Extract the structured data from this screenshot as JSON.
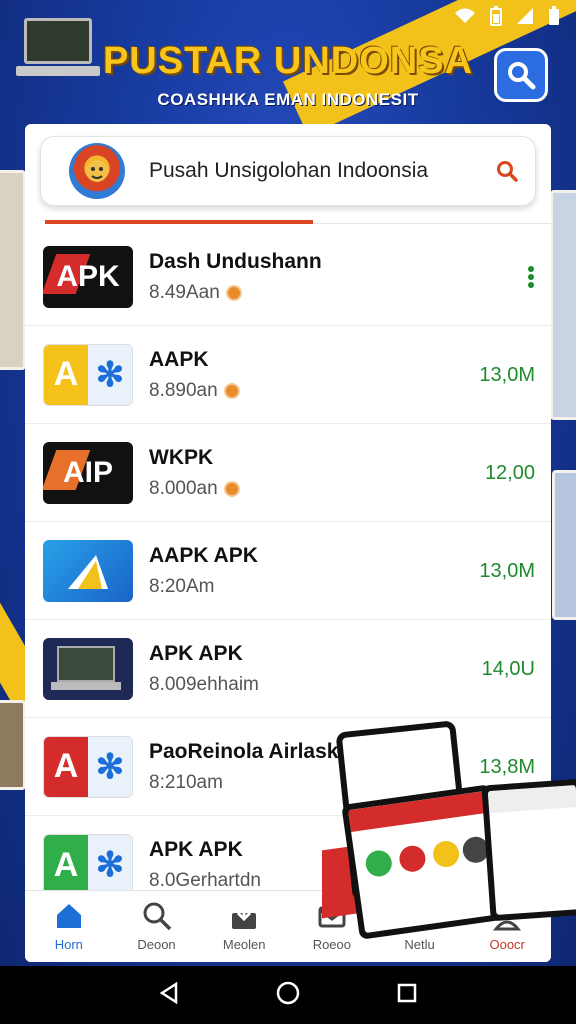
{
  "banner": {
    "title": "PUSTAR UNDONSA",
    "subtitle": "COASHHKA EMAN INDONESIT"
  },
  "search": {
    "placeholder": "Pusah Unsigolohan Indoonsia"
  },
  "apps": [
    {
      "name": "Dash Undushann",
      "size": "8.49Aan",
      "count": "",
      "icon": "apk-black-red"
    },
    {
      "name": "AAPK",
      "size": "8.890an",
      "count": "13,0M",
      "icon": "yellow-blue-split"
    },
    {
      "name": "WKPK",
      "size": "8.000an",
      "count": "12,00",
      "icon": "apk-black-orange"
    },
    {
      "name": "AAPK APK",
      "size": "8:20Am",
      "count": "13,0M",
      "icon": "blue-gradient"
    },
    {
      "name": "APK APK",
      "size": "8.009ehhaim",
      "count": "14,0U",
      "icon": "laptop"
    },
    {
      "name": "PaoReinola Airlask",
      "size": "8:210am",
      "count": "13,8M",
      "icon": "red-blue-split"
    },
    {
      "name": "APK APK",
      "size": "8.0Gerhartdn",
      "count": "",
      "icon": "green-blue-split"
    }
  ],
  "nav": [
    {
      "label": "Horn",
      "icon": "home-icon"
    },
    {
      "label": "Deoon",
      "icon": "search-icon"
    },
    {
      "label": "Meolen",
      "icon": "download-icon"
    },
    {
      "label": "Roeoo",
      "icon": "mail-icon"
    },
    {
      "label": "Netlu",
      "icon": "menu-icon"
    },
    {
      "label": "Ooocr",
      "icon": "profile-icon"
    }
  ],
  "colors": {
    "accent": "#d8471f",
    "count_green": "#1e8a2e",
    "banner_yellow": "#f7c51c",
    "nav_active": "#1c6fd6"
  }
}
